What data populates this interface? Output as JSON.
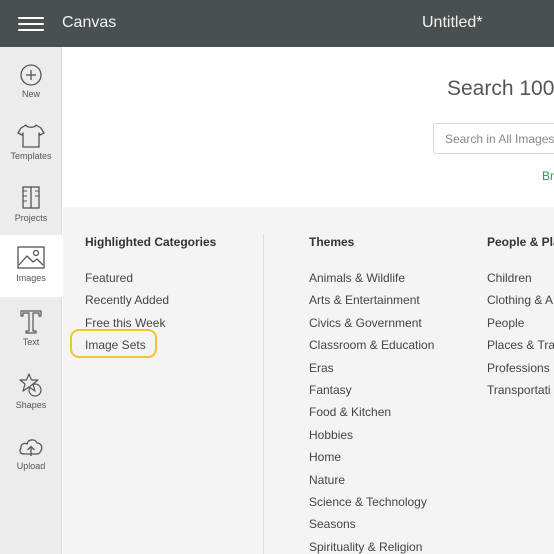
{
  "topbar": {
    "app_title": "Canvas",
    "doc_title": "Untitled*"
  },
  "sidebar": {
    "items": [
      {
        "label": "New",
        "icon": "plus-circle-icon"
      },
      {
        "label": "Templates",
        "icon": "tshirt-icon"
      },
      {
        "label": "Projects",
        "icon": "projects-icon"
      },
      {
        "label": "Images",
        "icon": "image-icon",
        "active": true
      },
      {
        "label": "Text",
        "icon": "text-icon"
      },
      {
        "label": "Shapes",
        "icon": "shapes-icon"
      },
      {
        "label": "Upload",
        "icon": "upload-cloud-icon"
      }
    ]
  },
  "search": {
    "heading": "Search 100",
    "placeholder": "Search in All Images",
    "browse_link": "Br"
  },
  "categories": {
    "highlighted": {
      "heading": "Highlighted Categories",
      "items": [
        "Featured",
        "Recently Added",
        "Free this Week",
        "Image Sets"
      ]
    },
    "themes": {
      "heading": "Themes",
      "items": [
        "Animals & Wildlife",
        "Arts & Entertainment",
        "Civics & Government",
        "Classroom & Education",
        "Eras",
        "Fantasy",
        "Food & Kitchen",
        "Hobbies",
        "Home",
        "Nature",
        "Science & Technology",
        "Seasons",
        "Spirituality & Religion"
      ]
    },
    "people": {
      "heading": "People & Pla",
      "items": [
        "Children",
        "Clothing & A",
        "People",
        "Places & Tra",
        "Professions",
        "Transportati"
      ]
    }
  },
  "colors": {
    "topbar_bg": "#4a4f52",
    "sidebar_bg": "#ececec",
    "categories_bg": "#f4f4f4",
    "link_green": "#1aa14a",
    "highlight_yellow": "#f4c430"
  }
}
